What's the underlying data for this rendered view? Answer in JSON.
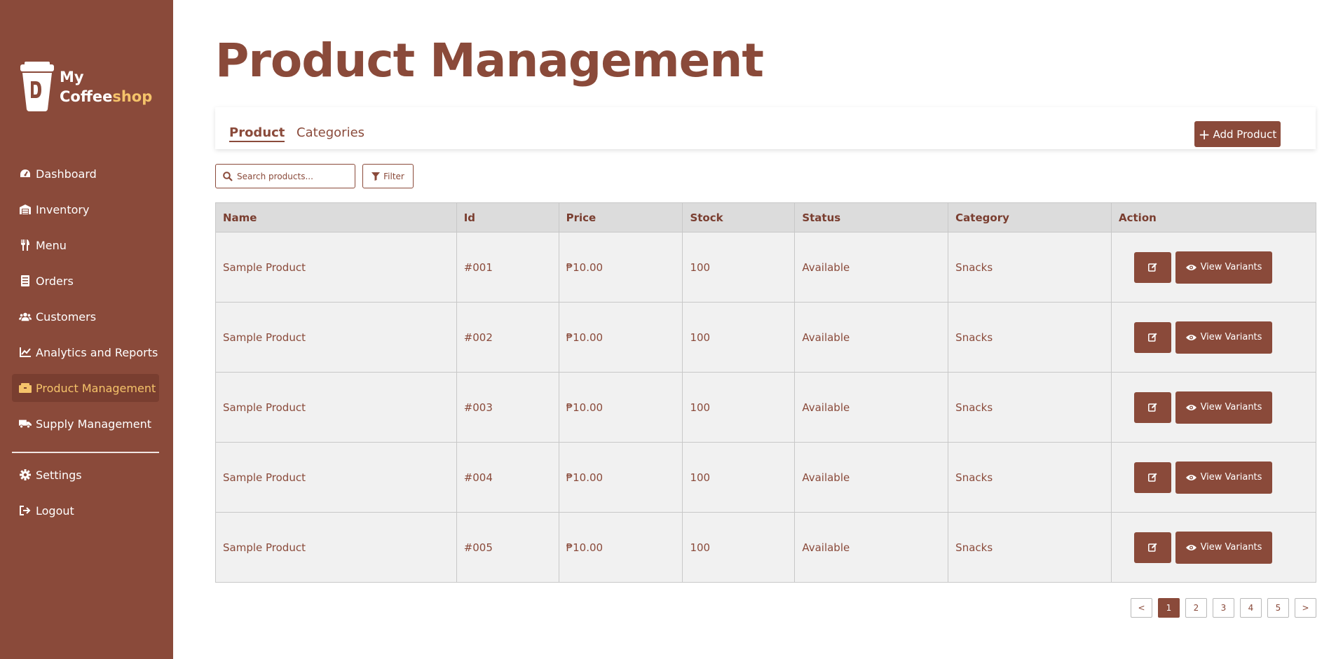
{
  "brand": {
    "line1": "My",
    "line2_main": "Coffee",
    "line2_accent": "shop"
  },
  "sidebar": {
    "items": [
      {
        "label": "Dashboard",
        "icon": "gauge-icon",
        "active": false
      },
      {
        "label": "Inventory",
        "icon": "warehouse-icon",
        "active": false
      },
      {
        "label": "Menu",
        "icon": "utensils-icon",
        "active": false
      },
      {
        "label": "Orders",
        "icon": "receipt-icon",
        "active": false
      },
      {
        "label": "Customers",
        "icon": "users-icon",
        "active": false
      },
      {
        "label": "Analytics and Reports",
        "icon": "chart-line-icon",
        "active": false
      },
      {
        "label": "Product Management",
        "icon": "boxes-icon",
        "active": true
      },
      {
        "label": "Supply Management",
        "icon": "truck-icon",
        "active": false
      }
    ],
    "bottom": [
      {
        "label": "Settings",
        "icon": "gear-icon"
      },
      {
        "label": "Logout",
        "icon": "logout-icon"
      }
    ]
  },
  "page": {
    "title": "Product Management"
  },
  "tabs": [
    {
      "label": "Product",
      "active": true
    },
    {
      "label": "Categories",
      "active": false
    }
  ],
  "toolbar": {
    "add_label": "Add Product",
    "search_placeholder": "Search products...",
    "filter_label": "Filter"
  },
  "table": {
    "columns": [
      "Name",
      "Id",
      "Price",
      "Stock",
      "Status",
      "Category",
      "Action"
    ],
    "rows": [
      {
        "name": "Sample Product",
        "id": "#001",
        "price": "₱10.00",
        "stock": "100",
        "status": "Available",
        "category": "Snacks"
      },
      {
        "name": "Sample Product",
        "id": "#002",
        "price": "₱10.00",
        "stock": "100",
        "status": "Available",
        "category": "Snacks"
      },
      {
        "name": "Sample Product",
        "id": "#003",
        "price": "₱10.00",
        "stock": "100",
        "status": "Available",
        "category": "Snacks"
      },
      {
        "name": "Sample Product",
        "id": "#004",
        "price": "₱10.00",
        "stock": "100",
        "status": "Available",
        "category": "Snacks"
      },
      {
        "name": "Sample Product",
        "id": "#005",
        "price": "₱10.00",
        "stock": "100",
        "status": "Available",
        "category": "Snacks"
      }
    ],
    "view_label": "View Variants"
  },
  "pagination": {
    "prev": "<",
    "next": ">",
    "pages": [
      "1",
      "2",
      "3",
      "4",
      "5"
    ],
    "current": "1"
  },
  "colors": {
    "brand": "#8a4a3a",
    "accent": "#f5c36a",
    "header_bg": "#dcdcdc",
    "row_bg": "#f1f1f1"
  }
}
